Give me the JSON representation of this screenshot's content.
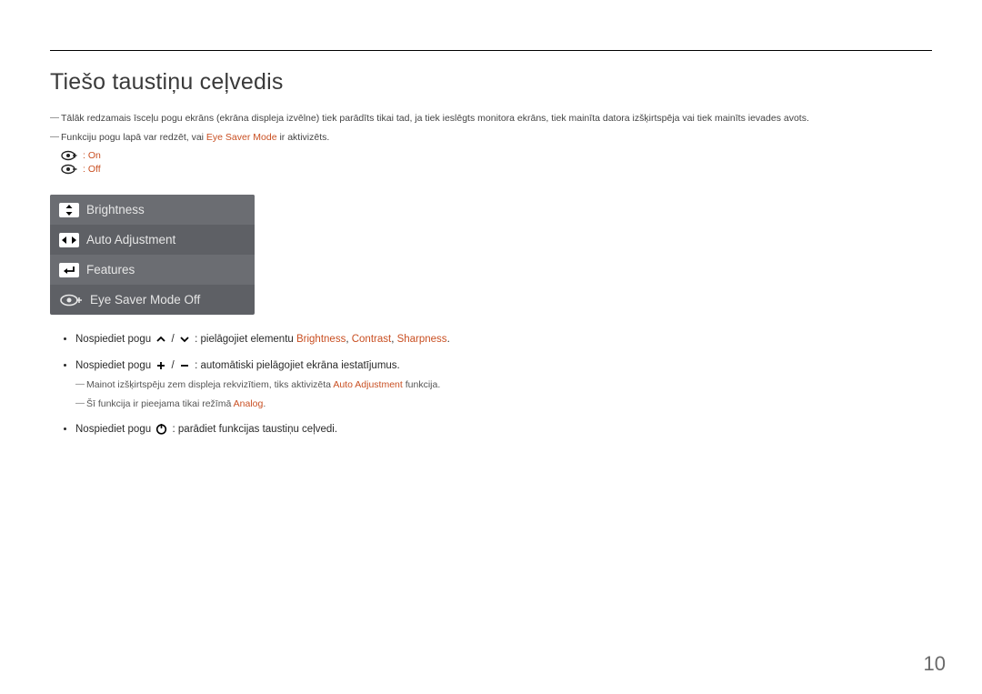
{
  "title": "Tiešo taustiņu ceļvedis",
  "note1": "Tālāk redzamais īsceļu pogu ekrāns (ekrāna displeja izvēlne) tiek parādīts tikai tad, ja tiek ieslēgts monitora ekrāns, tiek mainīta datora izšķirtspēja vai tiek mainīts ievades avots.",
  "note2_a": "Funkciju pogu lapā var redzēt, vai ",
  "note2_b": "Eye Saver Mode",
  "note2_c": " ir aktivizēts.",
  "status_on": ": On",
  "status_off": ": Off",
  "osd": {
    "brightness": "Brightness",
    "auto_adjustment": "Auto Adjustment",
    "features": "Features",
    "eye_saver": "Eye Saver Mode Off"
  },
  "bullets": {
    "b1_a": "Nospiediet pogu ",
    "b1_b": " / ",
    "b1_c": " : pielāgojiet elementu ",
    "b1_brightness": "Brightness",
    "b1_sep1": ", ",
    "b1_contrast": "Contrast",
    "b1_sep2": ", ",
    "b1_sharpness": "Sharpness",
    "b1_dot": ".",
    "b2_a": "Nospiediet pogu ",
    "b2_b": " / ",
    "b2_c": " : automātiski pielāgojiet ekrāna iestatījumus.",
    "b2_sub1_a": "Mainot izšķirtspēju zem displeja rekvizītiem, tiks aktivizēta ",
    "b2_sub1_b": "Auto Adjustment",
    "b2_sub1_c": " funkcija.",
    "b2_sub2_a": "Šī funkcija ir pieejama tikai režīmā ",
    "b2_sub2_b": "Analog",
    "b2_sub2_c": ".",
    "b3_a": "Nospiediet pogu ",
    "b3_b": " : parādiet funkcijas taustiņu ceļvedi."
  },
  "page_number": "10"
}
